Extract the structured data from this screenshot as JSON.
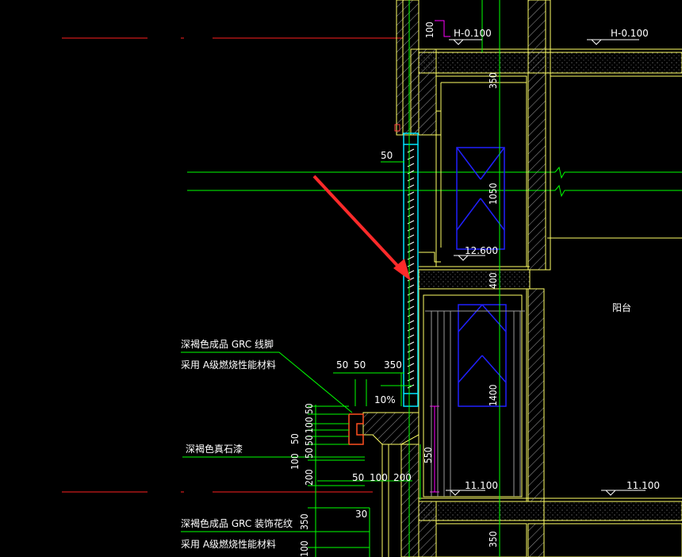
{
  "colors": {
    "background": "#000000",
    "wall": "#ffff66",
    "wall_dark": "#c8c800",
    "hatch": "#b0b0b0",
    "dimension": "#00ff00",
    "axis": "#ff2020",
    "window": "#2020ff",
    "frame_cyan": "#00e5ff",
    "magenta": "#ff00ff",
    "arrow": "#ff2a2a",
    "text": "#ffffff"
  },
  "elevations": {
    "top_left": "H-0.100",
    "top_right": "H-0.100",
    "mid": "12.600",
    "bottom_left": "11.100",
    "bottom_right": "11.100"
  },
  "dimensions": {
    "d100_top": "100",
    "d350_top": "350",
    "d50_side": "50",
    "d1050": "1050",
    "d400_mid": "400",
    "d1400": "1400",
    "d50_a": "50",
    "d50_b": "50",
    "d350_mid": "350",
    "slope": "10%",
    "stack_50a": "50",
    "stack_100": "100",
    "stack_50b": "50",
    "stack_50c": "50",
    "stack_50d": "50",
    "stack_100b": "100",
    "stack_200": "200",
    "stack_350": "350",
    "stack_100c": "100",
    "d550": "550",
    "d50_bot": "50",
    "d100_bot": "100",
    "d200_bot": "200",
    "d30": "30",
    "d350_bottom": "350"
  },
  "annotations": {
    "note1_line1": "深褐色成品  GRC 线脚",
    "note1_line2": "采用 A级燃烧性能材料",
    "note2": "深褐色真石漆",
    "note3_line1": "深褐色成品  GRC 装饰花纹",
    "note3_line2": "采用 A级燃烧性能材料",
    "room_label": "阳台"
  }
}
